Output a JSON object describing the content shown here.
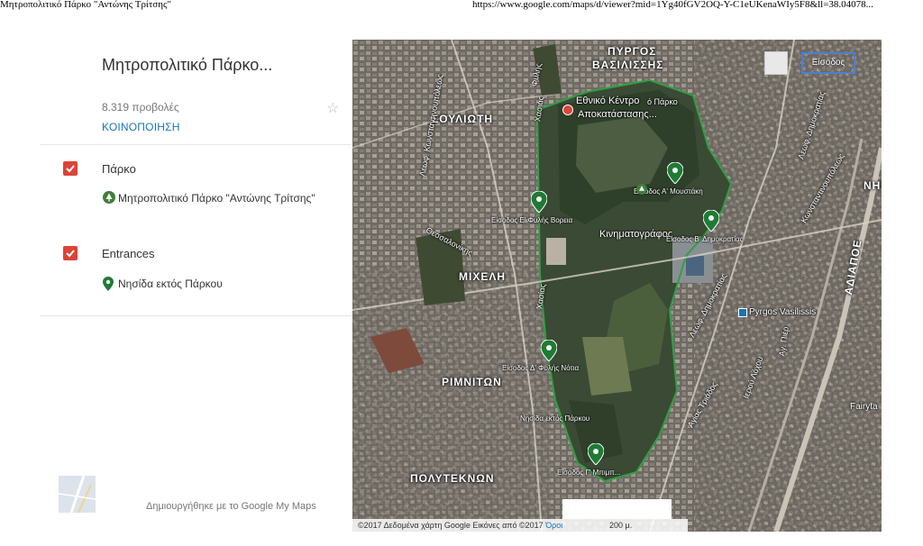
{
  "print_header": {
    "left": "Μητροπολιτικό Πάρκο \"Αντώνης Τρίτσης\"",
    "right": "https://www.google.com/maps/d/viewer?mid=1Yg40fGV2OQ-Y-C1eUKenaWIy5F8&ll=38.04078..."
  },
  "panel": {
    "title": "Μητροπολιτικό Πάρκο...",
    "views": "8.319 προβολές",
    "share_label": "ΚΟΙΝΟΠΟΙΗΣΗ",
    "layers": [
      {
        "name": "Πάρκο",
        "checked": true,
        "features": [
          {
            "label": "Μητροπολιτικό Πάρκο \"Αντώνης Τρίτσης\"",
            "icon": "park-tree-icon"
          }
        ]
      },
      {
        "name": "Entrances",
        "checked": true,
        "features": [
          {
            "label": "Νησίδα εκτός Πάρκου",
            "icon": "map-pin-icon"
          }
        ]
      }
    ],
    "footer": "Δημιουργήθηκε με το Google My Maps"
  },
  "map": {
    "areas": [
      "ΠΥΡΓΟΣ",
      "ΒΑΣΙΛΙΣΣΗΣ",
      "ΣΟΥΛΙΩΤΗ",
      "ΜΙΧΕΛΗ",
      "ΡΙΜΝΙΤΩΝ",
      "ΠΟΛΥΤΕΚΝΩΝ",
      "ΝΗΣΙΔ",
      "ΑΔΙΑΠΟΕ"
    ],
    "pois": {
      "center": "Εθνικό Κέντρο",
      "center2": "Αποκατάστασης...",
      "park_short": "ό Πάρκο",
      "cinema": "Κινηματογράφος",
      "pyrgos": "Pyrgos Vasilissis",
      "fairyta": "Fairyta",
      "entrance_ctrl": "Είσοδος"
    },
    "pins": [
      {
        "label": "Είσοδος Α' Μουστάκη"
      },
      {
        "label": "Είσοδος Ε' Φυλής Βορεια"
      },
      {
        "label": "Είσοδος Β' Δημοκρατίας"
      },
      {
        "label": "Είσοδος Δ' Φυλής Νότια"
      },
      {
        "label": "Νησίδα εκτός Πάρκου"
      },
      {
        "label": "Είσοδος Γ' Μπιμπ..."
      }
    ],
    "streets": [
      "Φυλής",
      "Θεσσαλονίκης",
      "Χασιάς",
      "Χασίας",
      "Λεωφ. Δημοκρατίας",
      "Λεωφ. Δημοκρατίας",
      "Λεωφ. Κωνσταντινουπόλεως",
      "Κωνσταντινουπόλεως",
      "Αγίας Τριάδος",
      "Ιερού Λόχου",
      "Αγ. Πιέρ"
    ],
    "attribution": "©2017 Δεδομένα χάρτη Google Εικόνες από ©2017",
    "terms": "Όροι",
    "scale": "200 μ."
  }
}
